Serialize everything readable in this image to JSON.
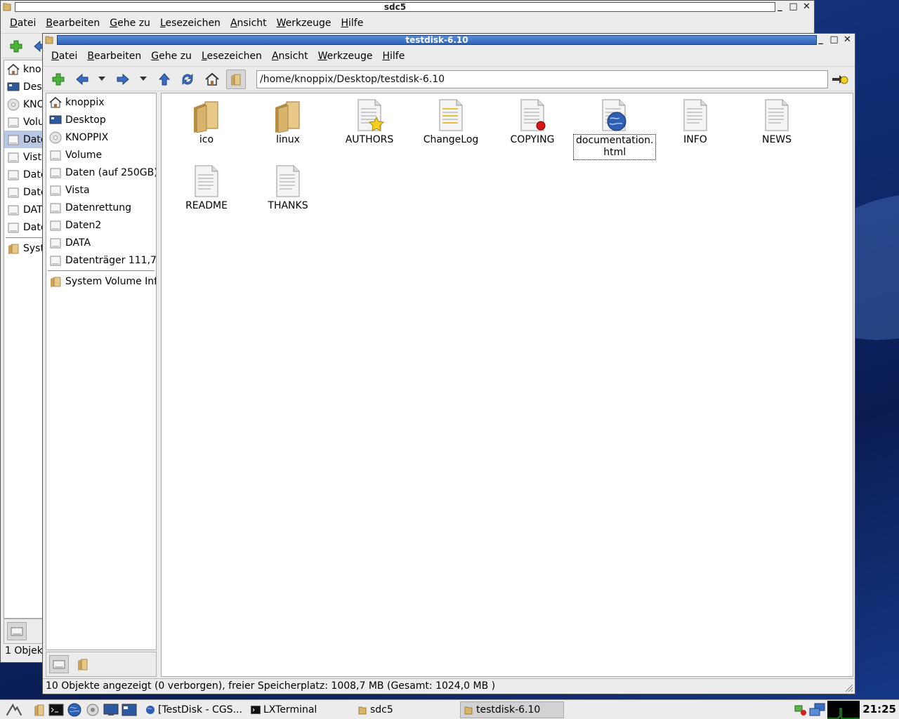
{
  "menu": {
    "items": [
      {
        "label": "Datei",
        "u": "D"
      },
      {
        "label": "Bearbeiten",
        "u": "B"
      },
      {
        "label": "Gehe zu",
        "u": "G"
      },
      {
        "label": "Lesezeichen",
        "u": "L"
      },
      {
        "label": "Ansicht",
        "u": "A"
      },
      {
        "label": "Werkzeuge",
        "u": "W"
      },
      {
        "label": "Hilfe",
        "u": "H"
      }
    ]
  },
  "back_window": {
    "title": "sdc5",
    "sidebar": [
      "kno",
      "Des",
      "KNO",
      "Volu",
      "Date",
      "Vista",
      "Date",
      "Date",
      "DAT",
      "Date",
      "Syst"
    ],
    "status": "1 Objek"
  },
  "front_window": {
    "title": "testdisk-6.10",
    "path": "/home/knoppix/Desktop/testdisk-6.10",
    "sidebar": [
      {
        "label": "knoppix",
        "icon": "home-icon"
      },
      {
        "label": "Desktop",
        "icon": "desktop-icon"
      },
      {
        "label": "KNOPPIX",
        "icon": "cdrom-icon"
      },
      {
        "label": "Volume",
        "icon": "drive-icon"
      },
      {
        "label": "Daten (auf 250GB)",
        "icon": "drive-icon"
      },
      {
        "label": "Vista",
        "icon": "drive-icon"
      },
      {
        "label": "Datenrettung",
        "icon": "drive-icon"
      },
      {
        "label": "Daten2",
        "icon": "drive-icon"
      },
      {
        "label": "DATA",
        "icon": "drive-icon"
      },
      {
        "label": "Datenträger 111,7",
        "icon": "drive-icon"
      }
    ],
    "bookmark": {
      "label": "System Volume Info",
      "icon": "folder-icon"
    },
    "files": [
      {
        "name": "ico",
        "type": "folder"
      },
      {
        "name": "linux",
        "type": "folder"
      },
      {
        "name": "AUTHORS",
        "type": "authors"
      },
      {
        "name": "ChangeLog",
        "type": "changelog"
      },
      {
        "name": "COPYING",
        "type": "copying"
      },
      {
        "name": "documentation.\nhtml",
        "type": "html"
      },
      {
        "name": "INFO",
        "type": "text"
      },
      {
        "name": "NEWS",
        "type": "text"
      },
      {
        "name": "README",
        "type": "text"
      },
      {
        "name": "THANKS",
        "type": "text"
      }
    ],
    "status": "10 Objekte angezeigt (0 verborgen), freier Speicherplatz: 1008,7 MB (Gesamt: 1024,0 MB )"
  },
  "taskbar": {
    "tasks": [
      {
        "label": "[TestDisk - CGS...",
        "icon": "browser-icon"
      },
      {
        "label": "LXTerminal",
        "icon": "terminal-icon"
      },
      {
        "label": "sdc5",
        "icon": "folder-icon"
      },
      {
        "label": "testdisk-6.10",
        "icon": "folder-icon"
      }
    ],
    "clock": "21:25"
  }
}
